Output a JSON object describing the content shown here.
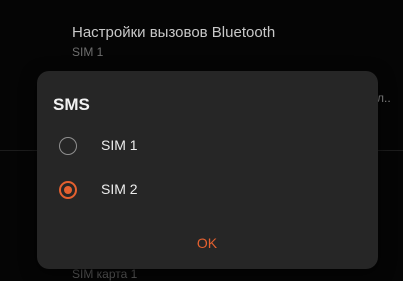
{
  "background": {
    "item_title": "Настройки вызовов Bluetooth",
    "item_subtitle": "SIM 1",
    "truncated_right": "л..",
    "bottom_partial": "SIM карта 1"
  },
  "dialog": {
    "title": "SMS",
    "options": [
      {
        "label": "SIM 1",
        "selected": false
      },
      {
        "label": "SIM 2",
        "selected": true
      }
    ],
    "ok_label": "OK"
  },
  "colors": {
    "accent": "#e4602f",
    "dialog_bg": "#262626",
    "screen_bg": "#050505"
  }
}
